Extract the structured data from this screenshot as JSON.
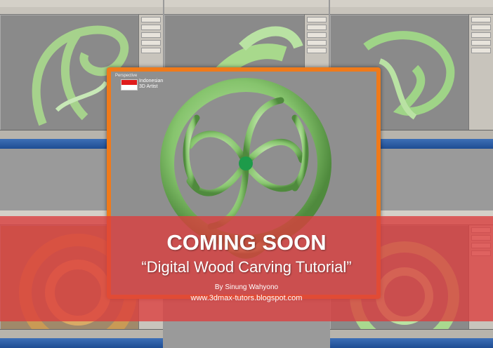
{
  "frame": {
    "viewport_label": "Perspective",
    "flag_line1": "Indonesian",
    "flag_line2": "3D Artist"
  },
  "banner": {
    "title": "COMING SOON",
    "subtitle": "“Digital Wood Carving Tutorial”",
    "author": "By Sinung Wahyono",
    "url": "www.3dmax-tutors.blogspot.com"
  },
  "colors": {
    "banner": "#dc3e3e",
    "frame_border": "#f07a1a",
    "carving_green": "#8ec97a",
    "carving_orange": "#e0704a",
    "flag_red": "#e01b1b"
  }
}
